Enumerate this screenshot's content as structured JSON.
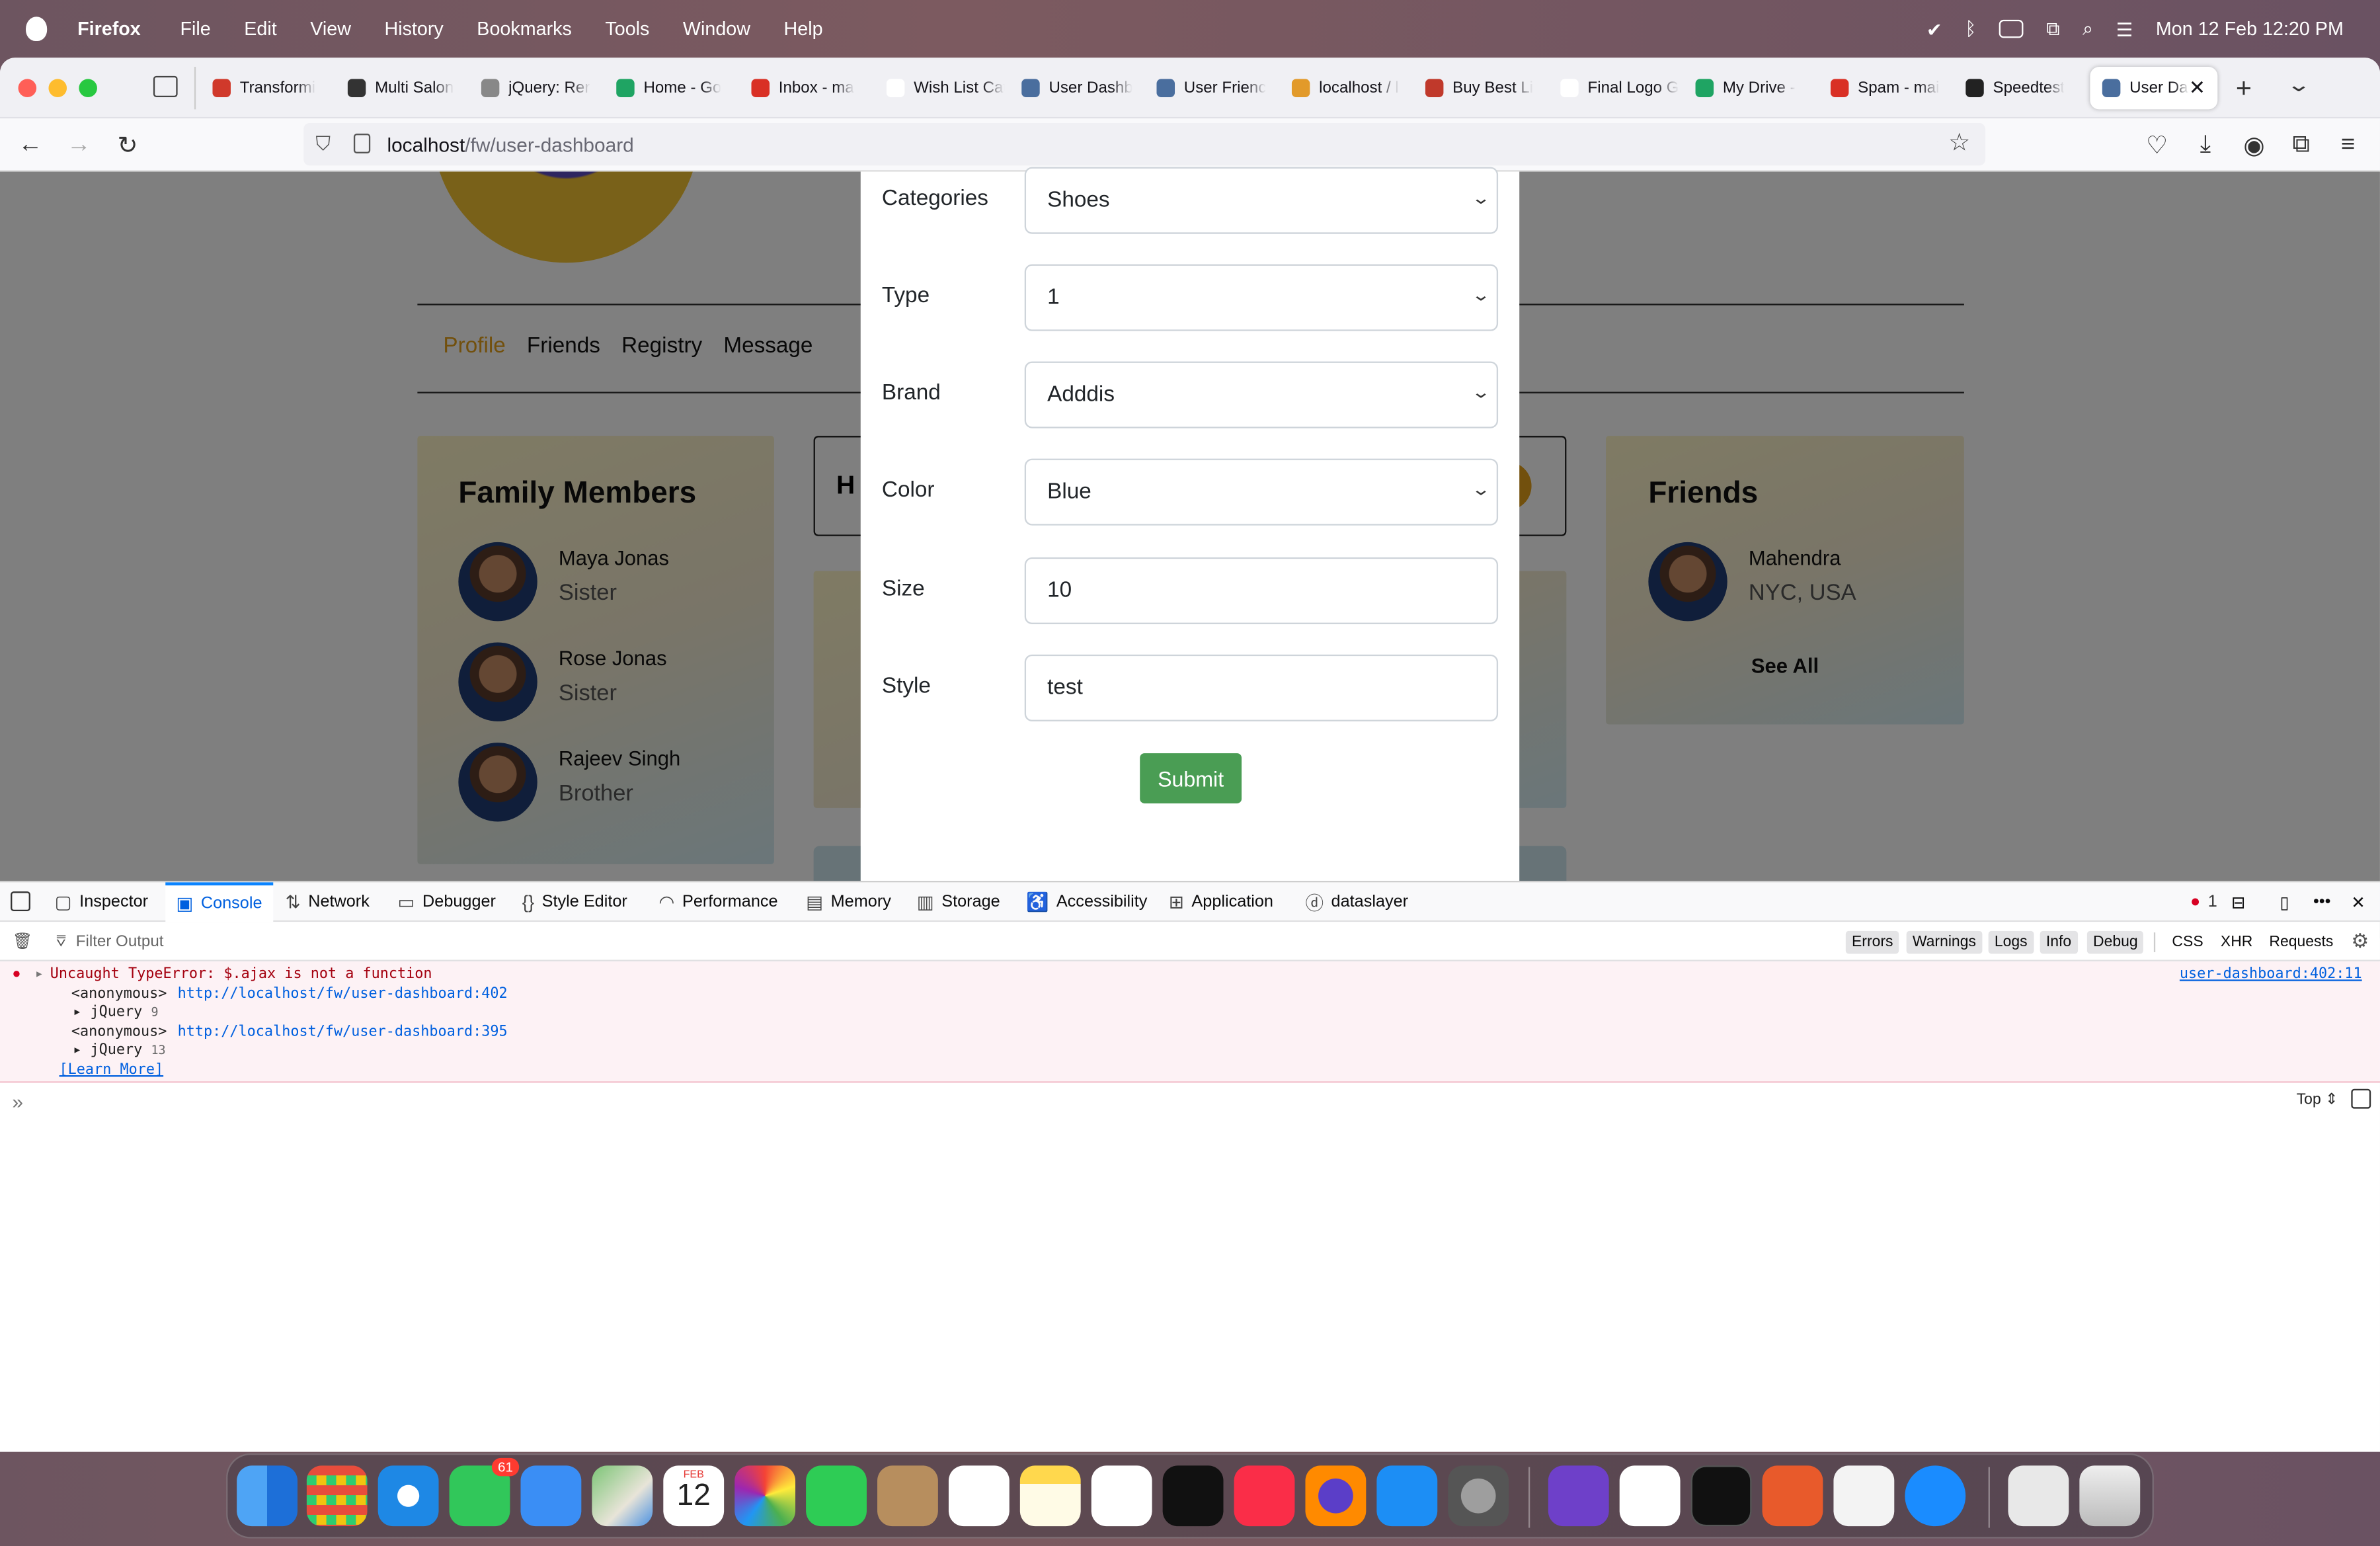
{
  "menubar": {
    "app": "Firefox",
    "items": [
      "File",
      "Edit",
      "View",
      "History",
      "Bookmarks",
      "Tools",
      "Window",
      "Help"
    ],
    "clock": "Mon 12 Feb  12:20 PM"
  },
  "tabs": [
    {
      "label": "Transformi",
      "color": "#d0392b"
    },
    {
      "label": "Multi Salon",
      "color": "#333333"
    },
    {
      "label": "jQuery: Rer",
      "color": "#888888"
    },
    {
      "label": "Home - Go",
      "color": "#1fa463"
    },
    {
      "label": "Inbox - ma",
      "color": "#d93025"
    },
    {
      "label": "Wish List Categ",
      "color": "#ffffff"
    },
    {
      "label": "User Dashb",
      "color": "#4a6e9e"
    },
    {
      "label": "User Frienc",
      "color": "#4a6e9e"
    },
    {
      "label": "localhost / l",
      "color": "#e29a2a"
    },
    {
      "label": "Buy Best Li",
      "color": "#c0392b"
    },
    {
      "label": "Final Logo Guid",
      "color": "#ffffff"
    },
    {
      "label": "My Drive -",
      "color": "#1fa463"
    },
    {
      "label": "Spam - mai",
      "color": "#d93025"
    },
    {
      "label": "Speedtest",
      "color": "#222222"
    }
  ],
  "active_tab": {
    "label": "User Da"
  },
  "address": {
    "host": "localhost",
    "path": "/fw/user-dashboard"
  },
  "profile_nav": [
    "Profile",
    "Friends",
    "Registry",
    "Message"
  ],
  "family": {
    "title": "Family Members",
    "members": [
      {
        "name": "Maya Jonas",
        "relation": "Sister"
      },
      {
        "name": "Rose Jonas",
        "relation": "Sister"
      },
      {
        "name": "Rajeev Singh",
        "relation": "Brother"
      }
    ]
  },
  "middle_header": "H",
  "friends": {
    "title": "Friends",
    "name": "Mahendra",
    "location": "NYC, USA",
    "see_all": "See All"
  },
  "form": {
    "fields": [
      {
        "label": "Categories",
        "value": "Shoes",
        "kind": "select"
      },
      {
        "label": "Type",
        "value": "1",
        "kind": "select"
      },
      {
        "label": "Brand",
        "value": "Adddis",
        "kind": "select"
      },
      {
        "label": "Color",
        "value": "Blue",
        "kind": "select"
      },
      {
        "label": "Size",
        "value": "10",
        "kind": "input"
      },
      {
        "label": "Style",
        "value": "test",
        "kind": "input"
      }
    ],
    "submit": "Submit"
  },
  "devtools": {
    "tabs": [
      "Inspector",
      "Console",
      "Network",
      "Debugger",
      "Style Editor",
      "Performance",
      "Memory",
      "Storage",
      "Accessibility",
      "Application",
      "dataslayer"
    ],
    "error_count": "1",
    "filter_placeholder": "Filter Output",
    "levels": [
      "Errors",
      "Warnings",
      "Logs",
      "Info",
      "Debug"
    ],
    "extras": [
      "CSS",
      "XHR",
      "Requests"
    ],
    "error": {
      "message": "Uncaught TypeError: $.ajax is not a function",
      "source": "user-dashboard:402:11",
      "frames": [
        {
          "fn": "<anonymous>",
          "url": "http://localhost/fw/user-dashboard:402"
        },
        {
          "group": "jQuery",
          "count": "9"
        },
        {
          "fn": "<anonymous>",
          "url": "http://localhost/fw/user-dashboard:395"
        },
        {
          "group": "jQuery",
          "count": "13"
        }
      ],
      "learn_more": "[Learn More]"
    },
    "context": "Top"
  },
  "dock": {
    "messages_badge": "61",
    "calendar_month": "FEB",
    "calendar_day": "12"
  },
  "colors": {
    "accent_orange": "#e4a11b",
    "submit_green": "#4a9d54",
    "console_blue": "#0a84ff"
  }
}
